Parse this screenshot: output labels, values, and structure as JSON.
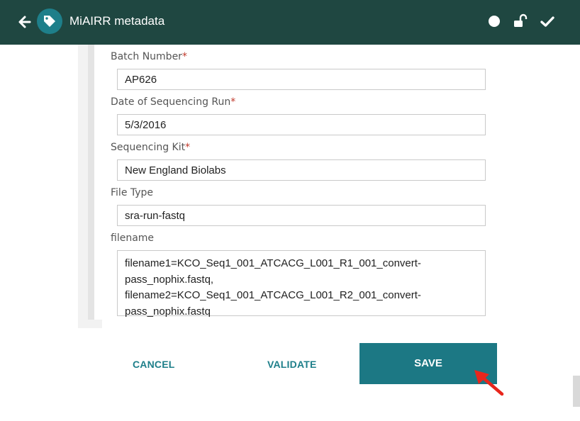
{
  "header": {
    "title": "MiAIRR metadata",
    "icons": [
      "back-arrow-icon",
      "tag-icon",
      "circle-icon",
      "unlock-icon",
      "check-icon"
    ],
    "colors": {
      "background": "#1f4741",
      "badge": "#1e7f8a"
    }
  },
  "form": {
    "required_marker": "*",
    "fields": [
      {
        "label": "Batch Number",
        "required": true,
        "value": "AP626"
      },
      {
        "label": "Date of Sequencing Run",
        "required": true,
        "value": "5/3/2016"
      },
      {
        "label": "Sequencing Kit",
        "required": true,
        "value": "New England Biolabs"
      },
      {
        "label": "File Type",
        "required": false,
        "value": "sra-run-fastq"
      },
      {
        "label": "filename",
        "required": false,
        "value": "filename1=KCO_Seq1_001_ATCACG_L001_R1_001_convert-\npass_nophix.fastq,\nfilename2=KCO_Seq1_001_ATCACG_L001_R2_001_convert-\npass_nophix.fastq"
      }
    ]
  },
  "actions": {
    "cancel_label": "CANCEL",
    "validate_label": "VALIDATE",
    "save_label": "SAVE",
    "colors": {
      "primary": "#1c7884",
      "pointer": "#e8261c"
    }
  }
}
